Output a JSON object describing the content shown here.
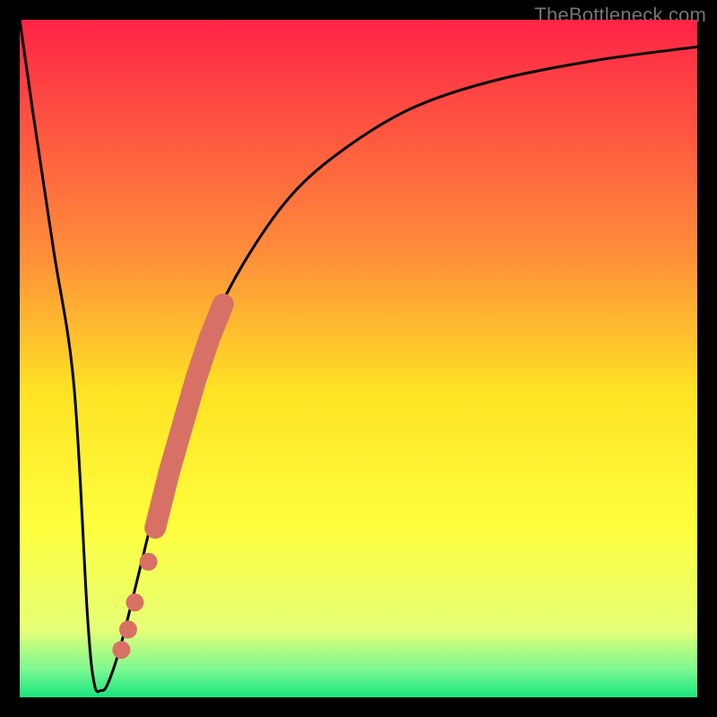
{
  "watermark": "TheBottleneck.com",
  "chart_data": {
    "type": "line",
    "title": "",
    "xlabel": "",
    "ylabel": "",
    "xlim": [
      0,
      100
    ],
    "ylim": [
      0,
      100
    ],
    "grid": false,
    "series": [
      {
        "name": "bottleneck-curve",
        "x": [
          0,
          2,
          5,
          8,
          10,
          11,
          12,
          13,
          15,
          18,
          20,
          24,
          28,
          33,
          40,
          48,
          58,
          70,
          85,
          100
        ],
        "y": [
          100,
          86,
          66,
          46,
          12,
          2,
          1,
          2,
          8,
          20,
          28,
          42,
          54,
          64,
          74,
          81,
          87,
          91,
          94,
          96
        ]
      }
    ],
    "points": {
      "name": "bottleneck-data-points",
      "x": [
        15,
        16,
        17,
        19,
        20,
        22,
        24,
        26,
        28,
        30
      ],
      "y": [
        7,
        10,
        14,
        20,
        25,
        33,
        40,
        47,
        53,
        58
      ],
      "color": "#d77165"
    },
    "gradient_stops": [
      {
        "pos": 0.0,
        "color": "#fe2446"
      },
      {
        "pos": 0.35,
        "color": "#fe8f3a"
      },
      {
        "pos": 0.55,
        "color": "#fee324"
      },
      {
        "pos": 0.75,
        "color": "#feff3e"
      },
      {
        "pos": 0.9,
        "color": "#e6ff76"
      },
      {
        "pos": 0.96,
        "color": "#7af891"
      },
      {
        "pos": 1.0,
        "color": "#16e57c"
      }
    ]
  }
}
